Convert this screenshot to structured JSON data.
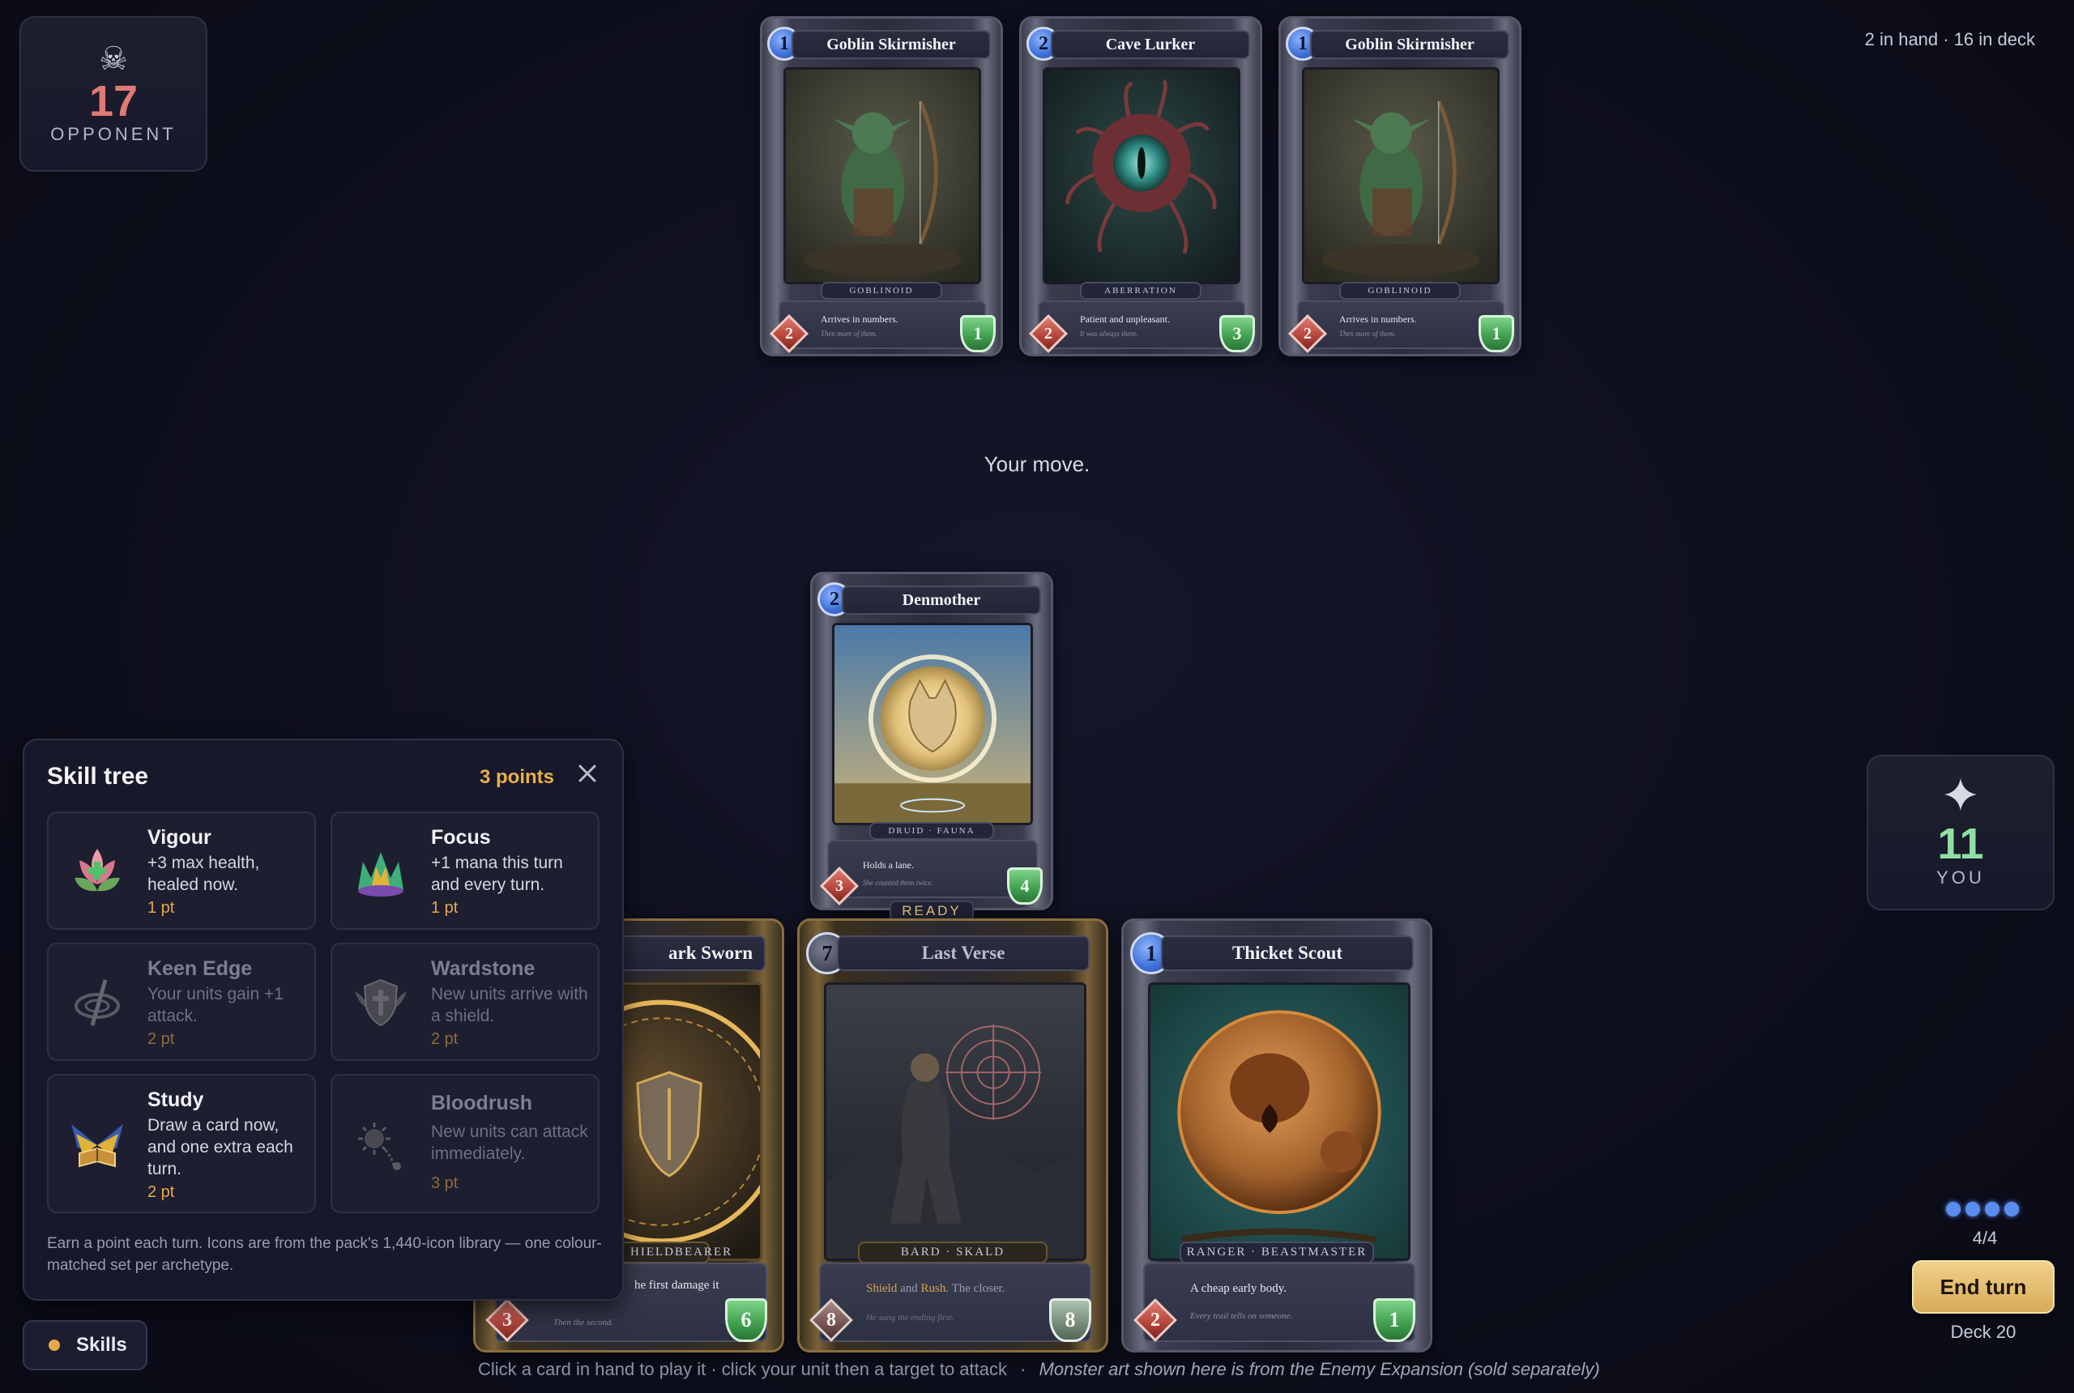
{
  "opponent": {
    "icon": "skull-crossbones-icon",
    "health": "17",
    "label": "OPPONENT"
  },
  "player": {
    "icon": "sparkle-star-icon",
    "health": "11",
    "label": "YOU"
  },
  "deck_info": "2 in hand · 16 in deck",
  "status_message": "Your move.",
  "enemy_board": [
    {
      "cost": "1",
      "name": "Goblin Skirmisher",
      "tribe": "GOBLINOID",
      "text": "Arrives in numbers.",
      "flavor": "Then more of them.",
      "attack": "2",
      "health": "1"
    },
    {
      "cost": "2",
      "name": "Cave Lurker",
      "tribe": "ABERRATION",
      "text": "Patient and unpleasant.",
      "flavor": "It was always there.",
      "attack": "2",
      "health": "3"
    },
    {
      "cost": "1",
      "name": "Goblin Skirmisher",
      "tribe": "GOBLINOID",
      "text": "Arrives in numbers.",
      "flavor": "Then more of them.",
      "attack": "2",
      "health": "1"
    }
  ],
  "player_board": [
    {
      "cost": "2",
      "name": "Denmother",
      "tribe": "DRUID · FAUNA",
      "text": "Holds a lane.",
      "flavor": "She counted them twice.",
      "attack": "3",
      "health": "4",
      "state": "READY"
    }
  ],
  "hand": [
    {
      "cost": "",
      "name": "ark Sworn",
      "tribe": "HIELDBEARER",
      "text": "he first damage it",
      "flavor": "Then the second.",
      "attack": "3",
      "health": "6"
    },
    {
      "cost": "7",
      "name": "Last Verse",
      "tribe": "BARD · SKALD",
      "text_keyword1": "Shield",
      "text_and": " and ",
      "text_keyword2": "Rush",
      "text_rest": ". The closer.",
      "flavor": "He sang the ending first.",
      "attack": "8",
      "health": "8"
    },
    {
      "cost": "1",
      "name": "Thicket Scout",
      "tribe": "RANGER · BEASTMASTER",
      "text": "A cheap early body.",
      "flavor": "Every trail tells on someone.",
      "attack": "2",
      "health": "1"
    }
  ],
  "skill_tree": {
    "title": "Skill tree",
    "points": "3 points",
    "close_icon": "close-icon",
    "skills": [
      {
        "name": "Vigour",
        "description": "+3 max health, healed now.",
        "cost": "1 pt",
        "icon": "lotus-heal-icon",
        "locked": false
      },
      {
        "name": "Focus",
        "description": "+1 mana this turn and every turn.",
        "cost": "1 pt",
        "icon": "crystal-crown-icon",
        "locked": false
      },
      {
        "name": "Keen Edge",
        "description": "Your units gain +1 attack.",
        "cost": "2 pt",
        "icon": "whirl-blade-icon",
        "locked": true
      },
      {
        "name": "Wardstone",
        "description": "New units arrive with a shield.",
        "cost": "2 pt",
        "icon": "winged-shield-icon",
        "locked": true
      },
      {
        "name": "Study",
        "description": "Draw a card now, and one extra each turn.",
        "cost": "2 pt",
        "icon": "winged-tome-icon",
        "locked": false
      },
      {
        "name": "Bloodrush",
        "description": "New units can attack immediately.",
        "cost": "3 pt",
        "icon": "spiked-flail-icon",
        "locked": true
      }
    ],
    "footer": "Earn a point each turn. Icons are from the pack's 1,440-icon library — one colour-matched set per archetype."
  },
  "skills_button": "Skills",
  "mana": {
    "current": 4,
    "max": 4,
    "text": "4/4"
  },
  "end_turn": "End turn",
  "deck_count": "Deck 20",
  "hint": "Click a card in hand to play it · click your unit then a target to attack",
  "credit": "Monster art shown here is from the Enemy Expansion (sold separately)",
  "colors": {
    "opponent_hp": "#e07a74",
    "player_hp": "#8fe0a4",
    "accent_gold": "#e7b04b",
    "mana_blue": "#5b8cf0"
  }
}
